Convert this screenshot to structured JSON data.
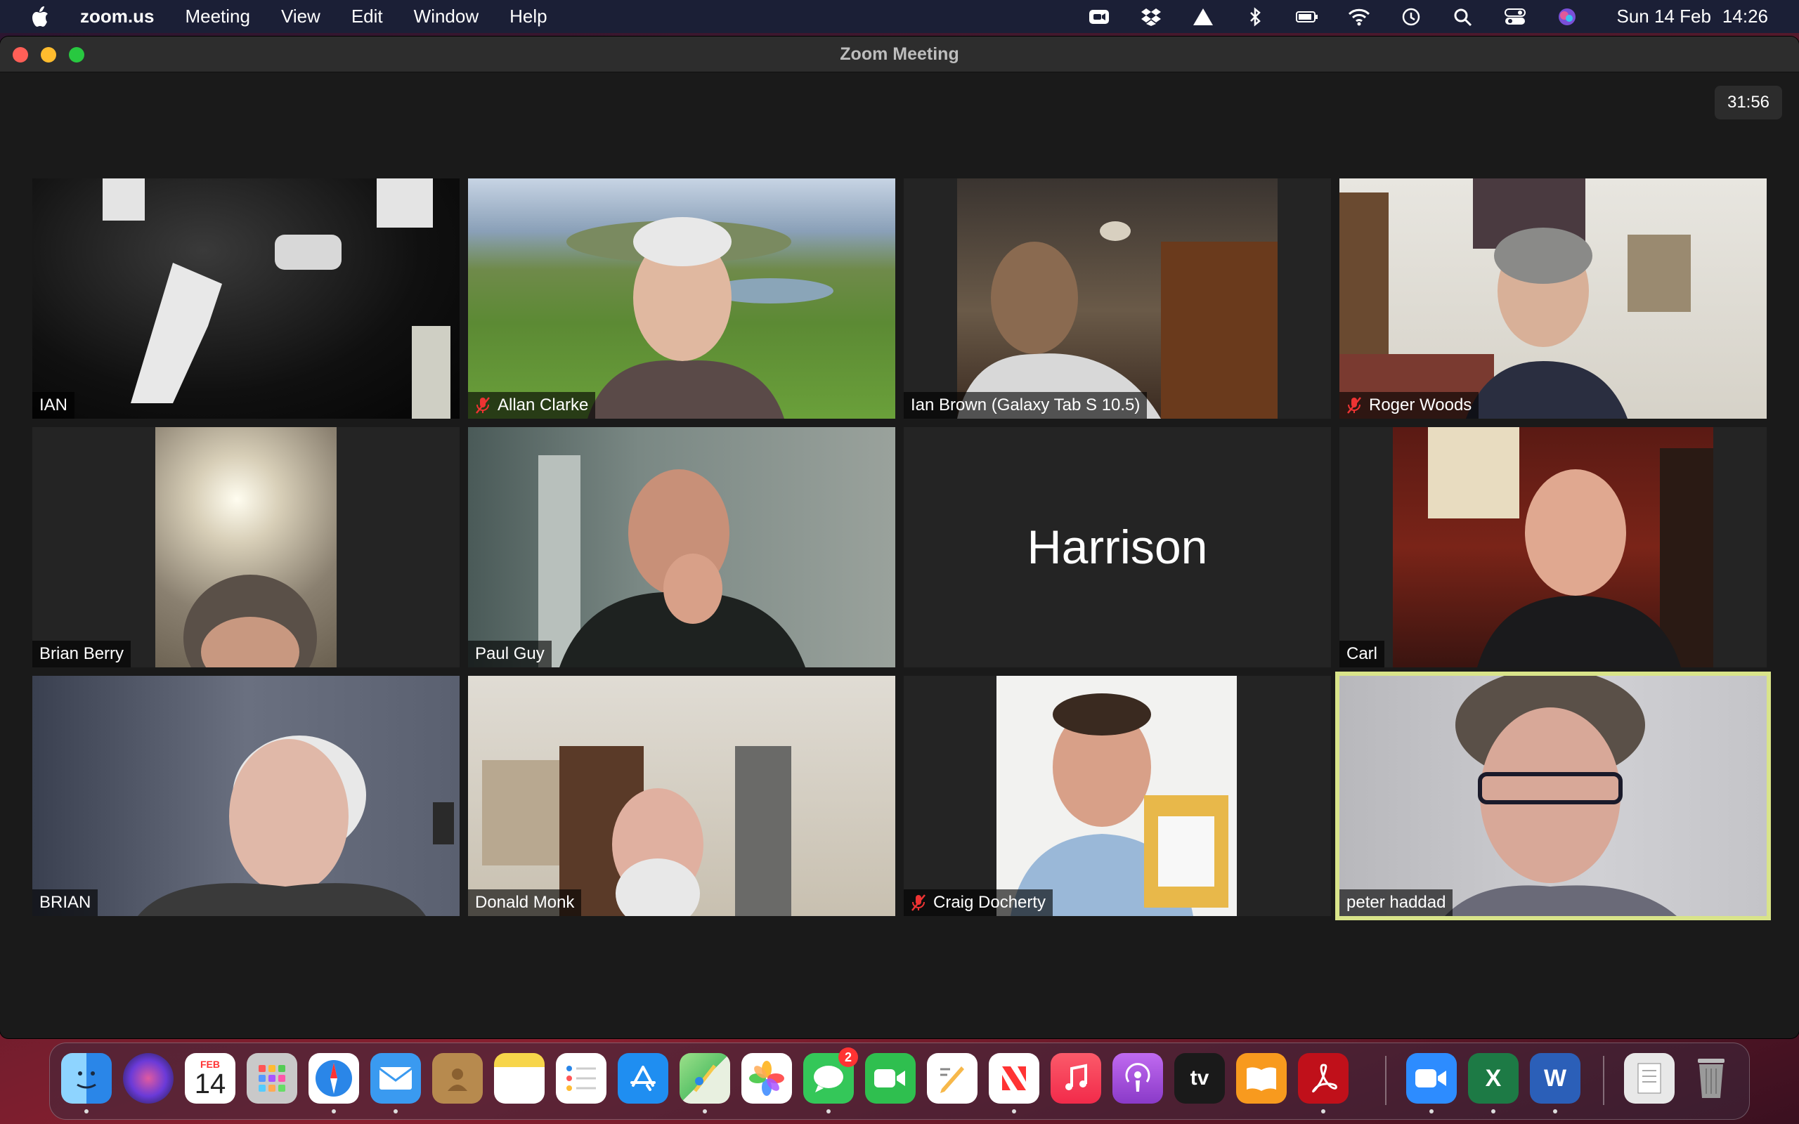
{
  "menubar": {
    "app_name": "zoom.us",
    "menus": [
      "Meeting",
      "View",
      "Edit",
      "Window",
      "Help"
    ],
    "status_icons": [
      "zoom-icon",
      "dropbox-icon",
      "drive-icon",
      "bluetooth-icon",
      "battery-icon",
      "wifi-icon",
      "time-machine-icon",
      "search-icon",
      "control-center-icon",
      "siri-icon"
    ],
    "date": "Sun 14 Feb",
    "time": "14:26"
  },
  "window": {
    "title": "Zoom Meeting",
    "timer": "31:56"
  },
  "participants": [
    {
      "name": "IAN",
      "muted": false
    },
    {
      "name": "Allan Clarke",
      "muted": true
    },
    {
      "name": "Ian Brown (Galaxy Tab S 10.5)",
      "muted": false
    },
    {
      "name": "Roger Woods",
      "muted": true
    },
    {
      "name": "Brian Berry",
      "muted": false
    },
    {
      "name": "Paul Guy",
      "muted": false
    },
    {
      "name": "Harrison",
      "muted": false,
      "video_off": true
    },
    {
      "name": "Carl",
      "muted": false
    },
    {
      "name": "BRIAN",
      "muted": false
    },
    {
      "name": "Donald Monk",
      "muted": false
    },
    {
      "name": "Craig Docherty",
      "muted": true
    },
    {
      "name": "peter haddad",
      "muted": false,
      "active_speaker": true
    }
  ],
  "dock": {
    "apps": [
      {
        "name": "finder-icon",
        "color": "#3a8ee6"
      },
      {
        "name": "siri-icon",
        "color": "#4b2f8c"
      },
      {
        "name": "calendar-icon",
        "color": "#ffffff",
        "month": "FEB",
        "day": "14"
      },
      {
        "name": "launchpad-icon",
        "color": "#c9c9c9"
      },
      {
        "name": "safari-icon",
        "color": "#2a86e8"
      },
      {
        "name": "mail-icon",
        "color": "#3a9af0"
      },
      {
        "name": "contacts-icon",
        "color": "#b78a4e"
      },
      {
        "name": "notes-icon",
        "color": "#f7d54a"
      },
      {
        "name": "reminders-icon",
        "color": "#ffffff"
      },
      {
        "name": "app-store-icon",
        "color": "#1f8ef1"
      },
      {
        "name": "maps-icon",
        "color": "#5dc46a"
      },
      {
        "name": "photos-icon",
        "color": "#ffffff"
      },
      {
        "name": "messages-icon",
        "color": "#34c759",
        "badge": "2"
      },
      {
        "name": "facetime-icon",
        "color": "#2fbf4f"
      },
      {
        "name": "textedit-icon",
        "color": "#ffffff"
      },
      {
        "name": "news-icon",
        "color": "#ffffff"
      },
      {
        "name": "music-icon",
        "color": "#fa3c55"
      },
      {
        "name": "podcasts-icon",
        "color": "#9b4bd8"
      },
      {
        "name": "apple-tv-icon",
        "color": "#1a1a1a",
        "label": "tv"
      },
      {
        "name": "books-icon",
        "color": "#f89a1e"
      },
      {
        "name": "acrobat-icon",
        "color": "#c0101a"
      },
      {
        "name": "zoom-icon",
        "color": "#2d8cff"
      },
      {
        "name": "excel-icon",
        "color": "#1d7a45",
        "label": "X"
      },
      {
        "name": "word-icon",
        "color": "#2b5fb8",
        "label": "W"
      },
      {
        "name": "documents-stack-icon",
        "color": "#e8e8e8"
      },
      {
        "name": "trash-icon",
        "color": "#9a9a9a"
      }
    ]
  }
}
